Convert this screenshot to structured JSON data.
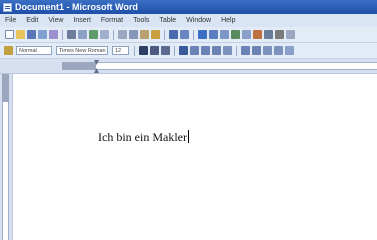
{
  "window": {
    "title": "Document1 - Microsoft Word"
  },
  "menu": {
    "items": [
      "File",
      "Edit",
      "View",
      "Insert",
      "Format",
      "Tools",
      "Table",
      "Window",
      "Help"
    ]
  },
  "formatting": {
    "style": "Normal",
    "font": "Times New Roman",
    "size": "12"
  },
  "document": {
    "text": "Ich bin ein Makler"
  },
  "colors": {
    "titlebar": "#2a5bb0",
    "toolbar": "#e3ebf7"
  }
}
